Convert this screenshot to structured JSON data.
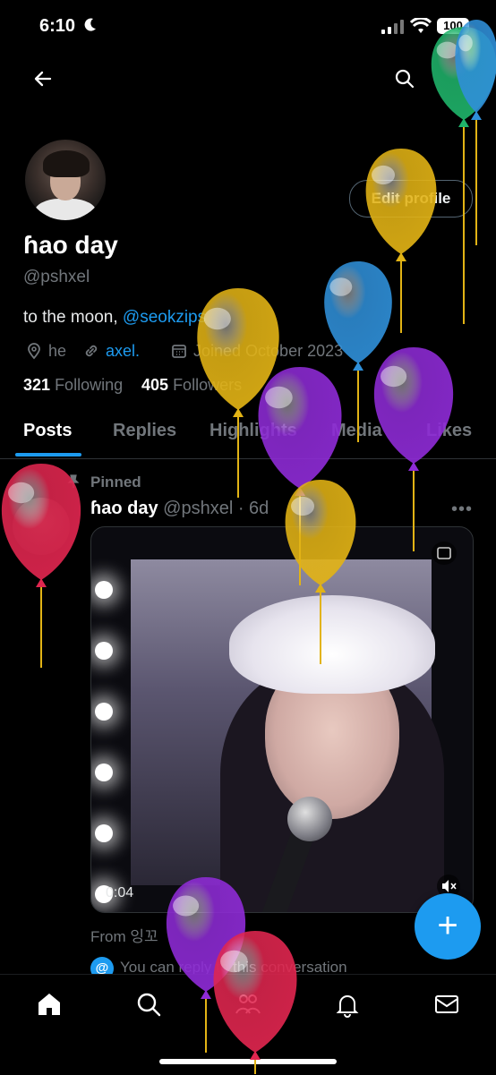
{
  "status_bar": {
    "time": "6:10",
    "battery": "100"
  },
  "profile": {
    "edit_button": "Edit profile",
    "display_name": "ɦao day",
    "handle": "@pshxel",
    "bio_text": "to the moon, ",
    "bio_mention": "@seokzips",
    "location": "he",
    "link": "axel.",
    "joined": "Joined October 2023",
    "following_count": "321",
    "following_label": "Following",
    "followers_count": "405",
    "followers_label": "Followers"
  },
  "tabs": [
    "Posts",
    "Replies",
    "Highlights",
    "Media",
    "Likes"
  ],
  "pinned_tweet": {
    "pinned_label": "Pinned",
    "author_name": "ɦao day",
    "author_handle": "@pshxel",
    "age": "· 6d",
    "video_time": "0:04",
    "from_text": "From 잉꼬",
    "reply_note": "You can reply to this conversation"
  },
  "colors": {
    "accent": "#1d9bf0",
    "balloon_yellow": "#e2b315",
    "balloon_blue": "#2f8fd8",
    "balloon_purple": "#8e2bd6",
    "balloon_red": "#e0264f",
    "balloon_green": "#1fb36a"
  },
  "icons": [
    "back-arrow-icon",
    "search-icon",
    "location-icon",
    "link-icon",
    "calendar-icon",
    "pin-icon",
    "more-icon",
    "mute-icon",
    "home-icon",
    "explore-icon",
    "communities-icon",
    "notifications-icon",
    "messages-icon"
  ]
}
